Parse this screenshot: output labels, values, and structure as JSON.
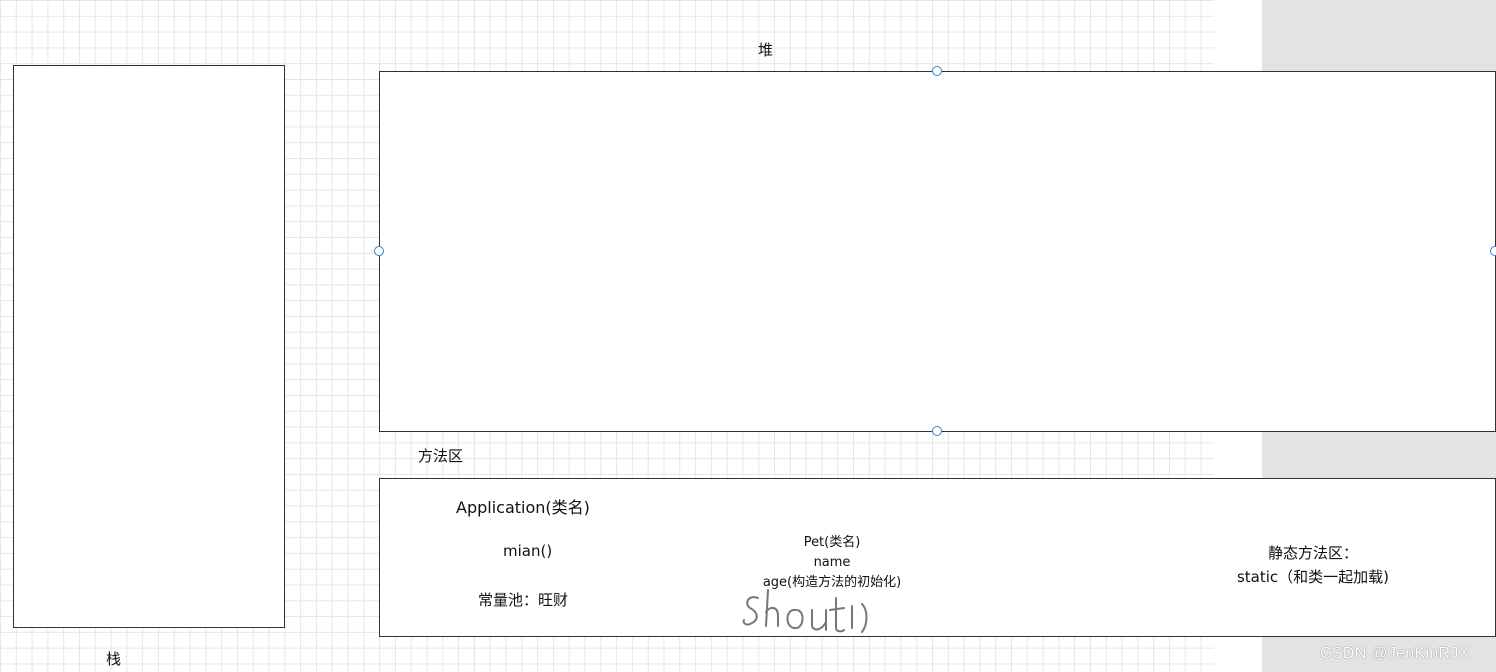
{
  "stack": {
    "label": "栈"
  },
  "heap": {
    "label": "堆"
  },
  "method_area": {
    "label": "方法区",
    "application_class": "Application(类名)",
    "main_method": "mian()",
    "constant_pool": "常量池：旺财",
    "pet_class": {
      "line1": "Pet(类名)",
      "line2": "name",
      "line3": "age(构造方法的初始化)"
    },
    "static_area": {
      "line1": "静态方法区：",
      "line2": "static（和类一起加载)"
    },
    "handwriting": "shoutu"
  },
  "watermark": "CSDN @JenKinRJX",
  "colors": {
    "grid": "#e6e6e6",
    "border": "#333333",
    "handle": "#3a7fd5",
    "side_panel": "#e3e3e3"
  }
}
